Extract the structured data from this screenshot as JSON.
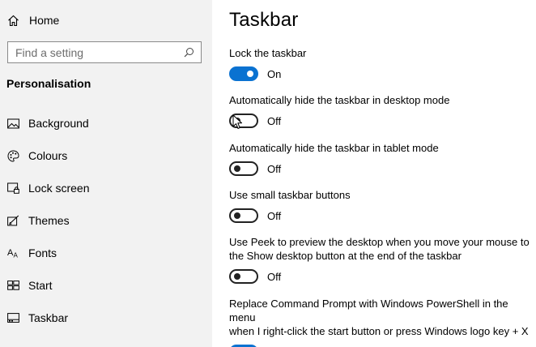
{
  "sidebar": {
    "home_label": "Home",
    "search_placeholder": "Find a setting",
    "section_title": "Personalisation",
    "items": [
      {
        "label": "Background",
        "icon": "image-icon"
      },
      {
        "label": "Colours",
        "icon": "palette-icon"
      },
      {
        "label": "Lock screen",
        "icon": "lock-screen-icon"
      },
      {
        "label": "Themes",
        "icon": "themes-icon"
      },
      {
        "label": "Fonts",
        "icon": "fonts-icon"
      },
      {
        "label": "Start",
        "icon": "start-icon"
      },
      {
        "label": "Taskbar",
        "icon": "taskbar-icon"
      }
    ]
  },
  "main": {
    "title": "Taskbar",
    "settings": [
      {
        "label": "Lock the taskbar",
        "state": "On"
      },
      {
        "label": "Automatically hide the taskbar in desktop mode",
        "state": "Off"
      },
      {
        "label": "Automatically hide the taskbar in tablet mode",
        "state": "Off"
      },
      {
        "label": "Use small taskbar buttons",
        "state": "Off"
      },
      {
        "label_line1": "Use Peek to preview the desktop when you move your mouse to",
        "label_line2": "the Show desktop button at the end of the taskbar",
        "state": "Off"
      },
      {
        "label_line1": "Replace Command Prompt with Windows PowerShell in the menu",
        "label_line2": "when I right-click the start button or press Windows logo key + X",
        "state": "On"
      }
    ]
  },
  "colors": {
    "accent": "#0a72d1",
    "sidebar_bg": "#f2f2f2"
  }
}
